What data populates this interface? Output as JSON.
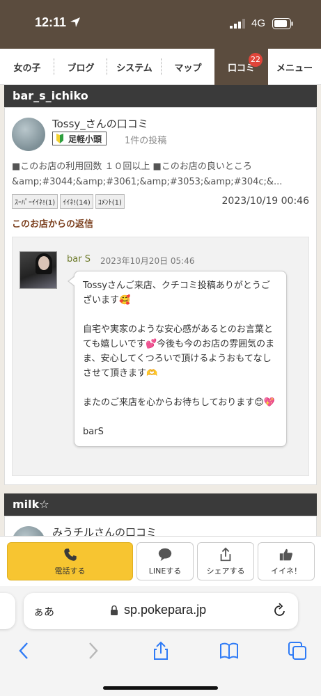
{
  "status": {
    "time": "12:11",
    "network": "4G"
  },
  "nav": {
    "tabs": [
      {
        "label": "女の子"
      },
      {
        "label": "ブログ"
      },
      {
        "label": "システム"
      },
      {
        "label": "マップ"
      },
      {
        "label": "口コミ",
        "badge": "22",
        "active": true
      },
      {
        "label": "メニュー"
      }
    ]
  },
  "review1": {
    "section_title": "bar_s_ichiko",
    "reviewer_name": "Tossy_さんの口コミ",
    "level": "足軽小頭",
    "post_count": "1件の投稿",
    "text_line1": "■このお店の利用回数 １０回以上 ■このお店の良いところ",
    "text_line2": "&amp;#3044;&amp;#3061;&amp;#3053;&amp;#304c;&...",
    "tags": [
      "ｽｰﾊﾟｰｲｲﾈ!(1)",
      "ｲｲﾈ!(14)",
      "ｺﾒﾝﾄ(1)"
    ],
    "date": "2023/10/19 00:46",
    "reply_title": "このお店からの返信",
    "shop_name": "bar S",
    "reply_date": "2023年10月20日 05:46",
    "reply_p1": "Tossyさんご来店、クチコミ投稿ありがとうございます🥰",
    "reply_p2": "自宅や実家のような安心感があるとのお言葉とても嬉しいです💕今後も今のお店の雰囲気のまま、安心してくつろいで頂けるようおもてなしさせて頂きます🫶",
    "reply_p3": "またのご来店を心からお待ちしております😊💖",
    "reply_p4": "barS"
  },
  "review2": {
    "section_title": "milk☆",
    "reviewer_name": "みうチルさんの口コミ"
  },
  "actions": {
    "call": "電話する",
    "line": "LINEする",
    "share": "シェアする",
    "like": "イイネ！"
  },
  "safari": {
    "aa": "ぁあ",
    "url": "sp.pokepara.jp"
  },
  "colors": {
    "header_brown": "#5b4c3e",
    "call_yellow": "#f7c531",
    "badge_red": "#e0453a"
  }
}
